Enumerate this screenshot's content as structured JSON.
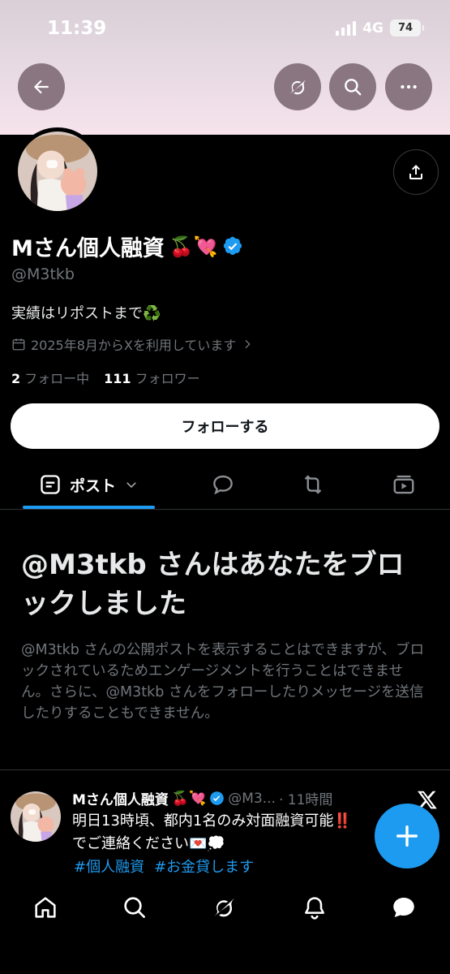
{
  "status_bar": {
    "time": "11:39",
    "network": "4G",
    "battery": "74"
  },
  "header": {
    "icons": [
      "back-arrow-icon",
      "grok-icon",
      "search-icon",
      "more-icon"
    ]
  },
  "profile": {
    "name": "Mさん個人融資",
    "name_emojis": "🍒💘",
    "handle": "@M3tkb",
    "bio": "実績はリポストまで♻️",
    "joined": "2025年8月からXを利用しています",
    "following_count": "2",
    "following_label": "フォロー中",
    "followers_count": "111",
    "followers_label": "フォロワー",
    "follow_button": "フォローする"
  },
  "tabs": {
    "posts_label": "ポスト"
  },
  "blocked": {
    "title": "@M3tkb さんはあなたをブロックしました",
    "description": "@M3tkb さんの公開ポストを表示することはできますが、ブロックされているためエンゲージメントを行うことはできません。さらに、@M3tkb さんをフォローしたりメッセージを送信したりすることもできません。"
  },
  "tweet": {
    "name": "Mさん個人融資",
    "name_emojis": "🍒💘",
    "handle": "@M3...",
    "time": "· 11時間",
    "line1": "明日13時頃、都内1名のみ対面融資可能‼️",
    "line2": "でご連絡ください💌💭",
    "hashtags": [
      "#個人融資",
      "#お金貸します"
    ]
  },
  "colors": {
    "accent": "#1d9bf0",
    "background": "#000000",
    "muted": "#71767b"
  }
}
